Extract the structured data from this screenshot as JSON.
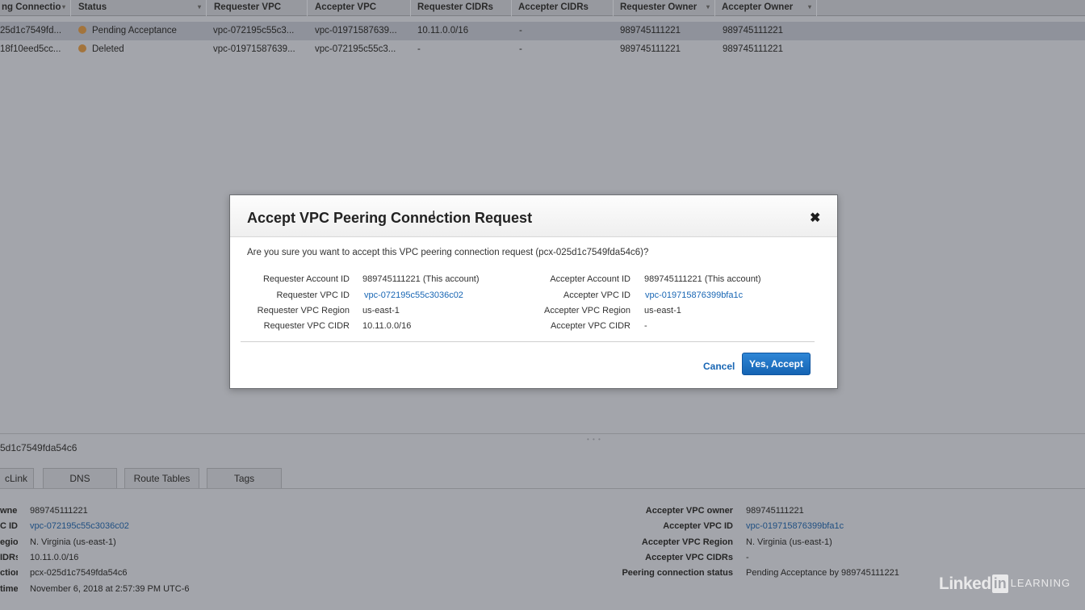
{
  "table": {
    "columns": [
      {
        "label": "ng Connectio"
      },
      {
        "label": "Status"
      },
      {
        "label": "Requester VPC"
      },
      {
        "label": "Accepter VPC"
      },
      {
        "label": "Requester CIDRs"
      },
      {
        "label": "Accepter CIDRs"
      },
      {
        "label": "Requester Owner"
      },
      {
        "label": "Accepter Owner"
      }
    ],
    "rows": [
      {
        "id": "25d1c7549fd...",
        "status": "Pending Acceptance",
        "requester_vpc": "vpc-072195c55c3...",
        "accepter_vpc": "vpc-01971587639...",
        "requester_cidrs": "10.11.0.0/16",
        "accepter_cidrs": "-",
        "requester_owner": "989745111221",
        "accepter_owner": "989745111221"
      },
      {
        "id": "18f10eed5cc...",
        "status": "Deleted",
        "requester_vpc": "vpc-01971587639...",
        "accepter_vpc": "vpc-072195c55c3...",
        "requester_cidrs": "-",
        "accepter_cidrs": "-",
        "requester_owner": "989745111221",
        "accepter_owner": "989745111221"
      }
    ],
    "status_color": "#a3743c"
  },
  "detail": {
    "selected_id": "5d1c7549fda54c6",
    "tabs": [
      "cLink",
      "DNS",
      "Route Tables",
      "Tags"
    ],
    "left": [
      {
        "label": "wner",
        "value": "989745111221"
      },
      {
        "label": "C ID",
        "value": "vpc-072195c55c3036c02"
      },
      {
        "label": "egion",
        "value": "N. Virginia (us-east-1)"
      },
      {
        "label": "IDRs",
        "value": "10.11.0.0/16"
      },
      {
        "label": "ction",
        "value": "pcx-025d1c7549fda54c6"
      },
      {
        "label": "time",
        "value": "November 6, 2018 at 2:57:39 PM UTC-6"
      }
    ],
    "right": [
      {
        "label": "Accepter VPC owner",
        "value": "989745111221"
      },
      {
        "label": "Accepter VPC ID",
        "value": "vpc-019715876399bfa1c"
      },
      {
        "label": "Accepter VPC Region",
        "value": "N. Virginia (us-east-1)"
      },
      {
        "label": "Accepter VPC CIDRs",
        "value": "-"
      },
      {
        "label": "Peering connection status",
        "value": "Pending Acceptance by 989745111221"
      }
    ]
  },
  "modal": {
    "title": "Accept VPC Peering Connection Request",
    "question": "Are you sure you want to accept this VPC peering connection request (pcx-025d1c7549fda54c6)?",
    "left": [
      {
        "label": "Requester Account ID",
        "value": "989745111221 (This account)"
      },
      {
        "label": "Requester VPC ID",
        "value": "vpc-072195c55c3036c02"
      },
      {
        "label": "Requester VPC Region",
        "value": "us-east-1"
      },
      {
        "label": "Requester VPC CIDR",
        "value": "10.11.0.0/16"
      }
    ],
    "right": [
      {
        "label": "Accepter Account ID",
        "value": "989745111221 (This account)"
      },
      {
        "label": "Accepter VPC ID",
        "value": "vpc-019715876399bfa1c"
      },
      {
        "label": "Accepter VPC Region",
        "value": "us-east-1"
      },
      {
        "label": "Accepter VPC CIDR",
        "value": "-"
      }
    ],
    "cancel_label": "Cancel",
    "accept_label": "Yes, Accept",
    "accent_color": "#1866b4",
    "close_icon": "close-icon"
  },
  "watermark": {
    "brand_word": "Linked",
    "brand_in": "in",
    "brand_suffix": "LEARNING"
  }
}
